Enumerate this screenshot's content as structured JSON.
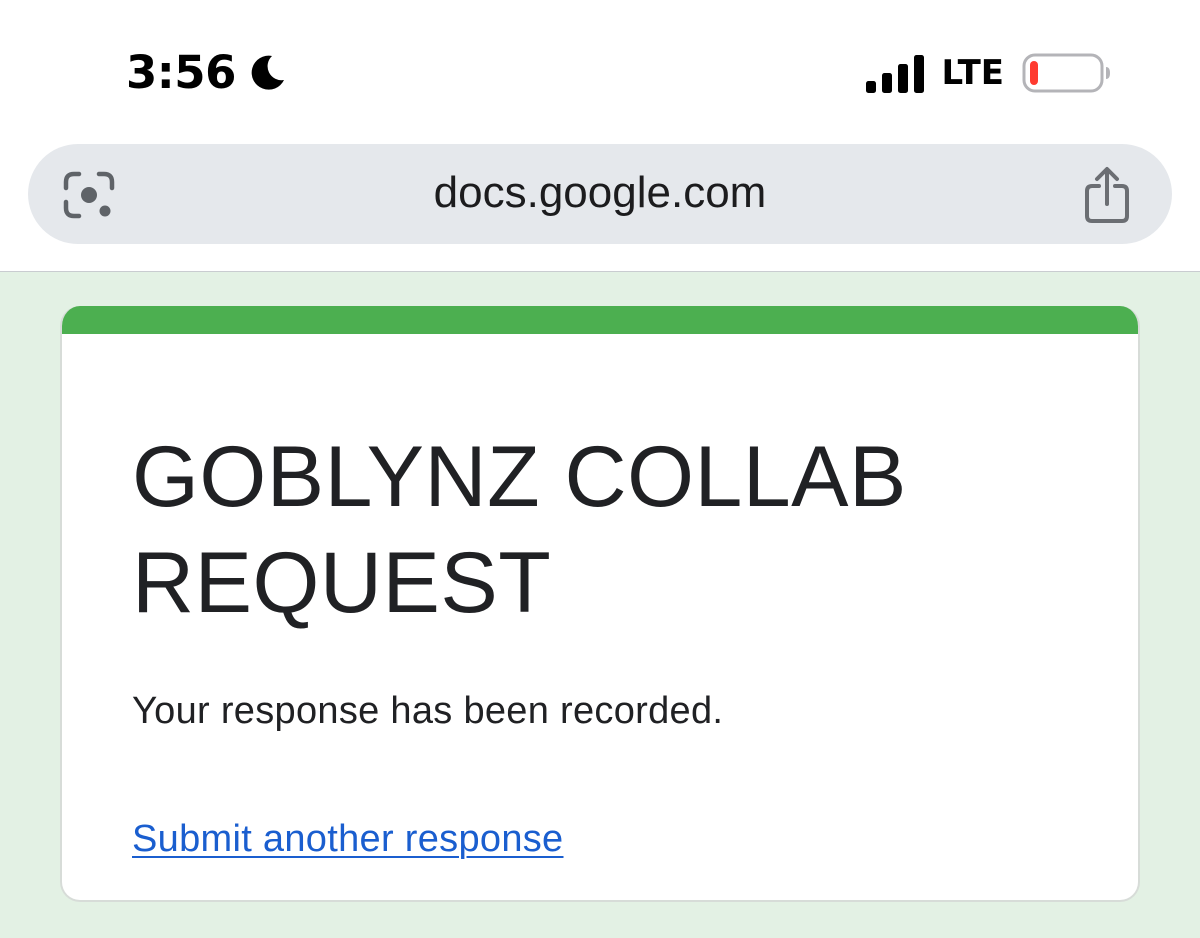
{
  "status_bar": {
    "time": "3:56",
    "focus_icon": "moon-icon",
    "signal_icon": "cellular-signal-icon",
    "network": "LTE",
    "battery_icon": "battery-low-icon",
    "battery_level_fraction": 0.12,
    "battery_color": "#ff3b30"
  },
  "address_bar": {
    "left_icon": "google-lens-icon",
    "url": "docs.google.com",
    "right_icon": "share-icon"
  },
  "form": {
    "title": "GOBLYNZ COLLAB REQUEST",
    "confirmation": "Your response has been recorded.",
    "submit_another_label": "Submit another response",
    "accent_color": "#4caf50",
    "page_background": "#e3f1e4",
    "link_color": "#1a5ecf"
  }
}
